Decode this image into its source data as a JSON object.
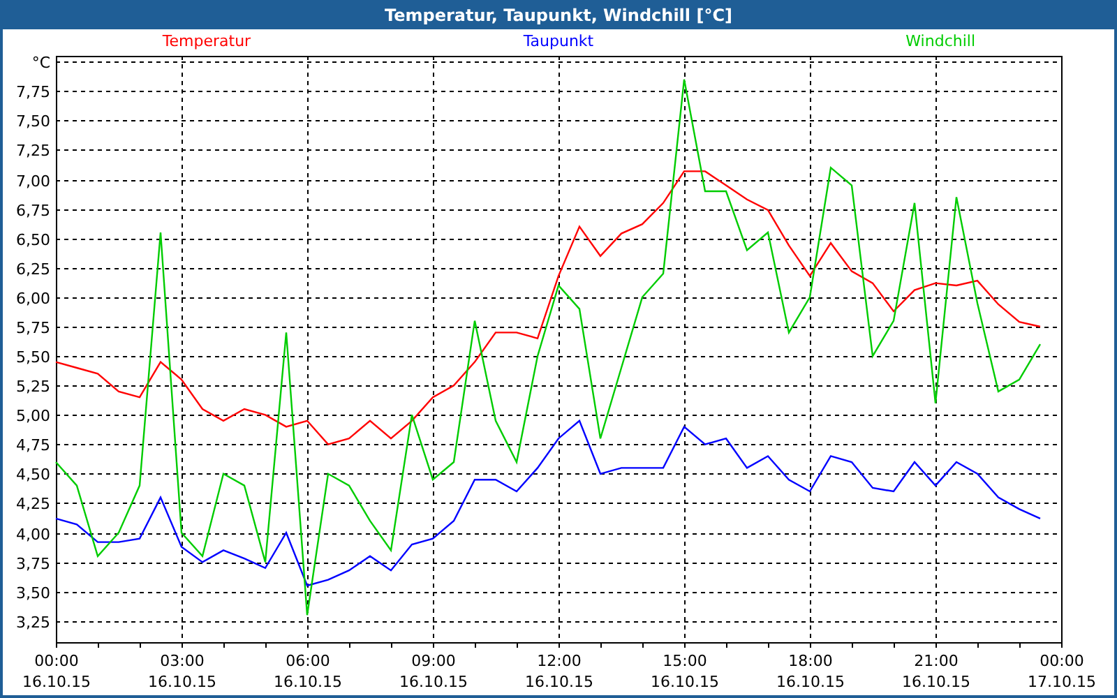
{
  "window": {
    "title": "Temperatur, Taupunkt, Windchill [°C]"
  },
  "chart": {
    "chart_data": {
      "type": "line",
      "categories": [
        "00:00 16.10.15",
        null,
        null,
        null,
        null,
        null,
        "03:00 16.10.15",
        null,
        null,
        null,
        null,
        null,
        "06:00 16.10.15",
        null,
        null,
        null,
        null,
        null,
        "09:00 16.10.15",
        null,
        null,
        null,
        null,
        null,
        "12:00 16.10.15",
        null,
        null,
        null,
        null,
        null,
        "15:00 16.10.15",
        null,
        null,
        null,
        null,
        null,
        "18:00 16.10.15",
        null,
        null,
        null,
        null,
        null,
        "21:00 16.10.15",
        null,
        null,
        null,
        null,
        null,
        "00:00 17.10.15"
      ],
      "series": [
        {
          "name": "Temperatur",
          "color": "#ff0000",
          "values": [
            5.45,
            5.4,
            5.35,
            5.2,
            5.15,
            5.45,
            5.3,
            5.05,
            4.95,
            5.05,
            5.0,
            4.9,
            4.95,
            4.75,
            4.8,
            4.95,
            4.8,
            4.95,
            5.15,
            5.25,
            5.45,
            5.7,
            5.7,
            5.65,
            6.18,
            6.6,
            6.35,
            6.54,
            6.62,
            6.8,
            7.07,
            7.07,
            6.95,
            6.83,
            6.74,
            6.44,
            6.18,
            6.46,
            6.22,
            6.12,
            5.88,
            6.06,
            6.12,
            6.1,
            6.14,
            5.94,
            5.79,
            5.75,
            null
          ]
        },
        {
          "name": "Taupunkt",
          "color": "#0000ff",
          "values": [
            4.12,
            4.07,
            3.92,
            3.92,
            3.95,
            4.3,
            3.88,
            3.75,
            3.85,
            3.78,
            3.7,
            4.0,
            3.55,
            3.6,
            3.68,
            3.8,
            3.68,
            3.9,
            3.95,
            4.1,
            4.45,
            4.45,
            4.35,
            4.55,
            4.8,
            4.95,
            4.5,
            4.55,
            4.55,
            4.55,
            4.9,
            4.75,
            4.8,
            4.55,
            4.65,
            4.45,
            4.35,
            4.65,
            4.6,
            4.38,
            4.35,
            4.6,
            4.4,
            4.6,
            4.5,
            4.3,
            4.2,
            4.12,
            null
          ]
        },
        {
          "name": "Windchill",
          "color": "#00cc00",
          "values": [
            4.6,
            4.4,
            3.8,
            4.0,
            4.4,
            6.55,
            4.0,
            3.8,
            4.5,
            4.4,
            3.75,
            5.7,
            3.3,
            4.5,
            4.4,
            4.1,
            3.85,
            5.0,
            4.45,
            4.6,
            5.8,
            4.95,
            4.6,
            5.5,
            6.1,
            5.9,
            4.8,
            5.4,
            6.0,
            6.2,
            7.85,
            6.9,
            6.9,
            6.4,
            6.55,
            5.7,
            6.0,
            7.1,
            6.95,
            5.5,
            5.8,
            6.8,
            5.1,
            6.85,
            5.95,
            5.2,
            5.3,
            5.6,
            null
          ]
        }
      ],
      "grid": true,
      "ylim": [
        3.07,
        8.05
      ],
      "yticks": [
        {
          "value": 3.25,
          "label": "3,25"
        },
        {
          "value": 3.5,
          "label": "3,50"
        },
        {
          "value": 3.75,
          "label": "3,75"
        },
        {
          "value": 4,
          "label": "4,00"
        },
        {
          "value": 4.25,
          "label": "4,25"
        },
        {
          "value": 4.5,
          "label": "4,50"
        },
        {
          "value": 4.75,
          "label": "4,75"
        },
        {
          "value": 5,
          "label": "5,00"
        },
        {
          "value": 5.25,
          "label": "5,25"
        },
        {
          "value": 5.5,
          "label": "5,50"
        },
        {
          "value": 5.75,
          "label": "5,75"
        },
        {
          "value": 6,
          "label": "6,00"
        },
        {
          "value": 6.25,
          "label": "6,25"
        },
        {
          "value": 6.5,
          "label": "6,50"
        },
        {
          "value": 6.75,
          "label": "6,75"
        },
        {
          "value": 7,
          "label": "7,00"
        },
        {
          "value": 7.25,
          "label": "7,25"
        },
        {
          "value": 7.5,
          "label": "7,50"
        },
        {
          "value": 7.75,
          "label": "7,75"
        },
        {
          "value": 8,
          "label": "°C"
        }
      ]
    }
  }
}
